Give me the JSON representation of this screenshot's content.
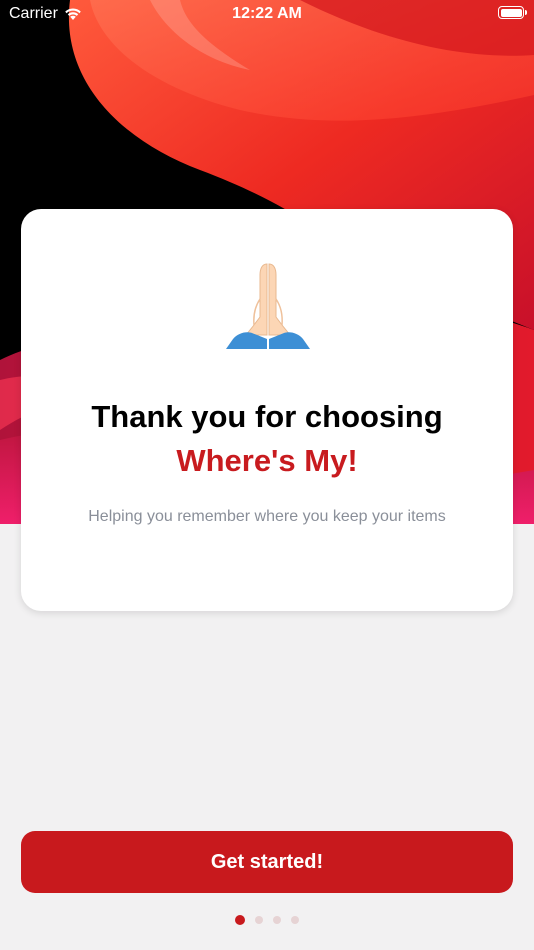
{
  "status_bar": {
    "carrier": "Carrier",
    "time": "12:22 AM"
  },
  "card": {
    "icon": "folded-hands-icon",
    "title": "Thank you for choosing",
    "brand": "Where's My!",
    "subtitle": "Helping you remember where you keep your items"
  },
  "cta": {
    "label": "Get started!"
  },
  "pagination": {
    "count": 4,
    "active_index": 0
  },
  "colors": {
    "accent": "#c8191d",
    "background": "#f2f1f2",
    "subtitle": "#8a8f99"
  }
}
